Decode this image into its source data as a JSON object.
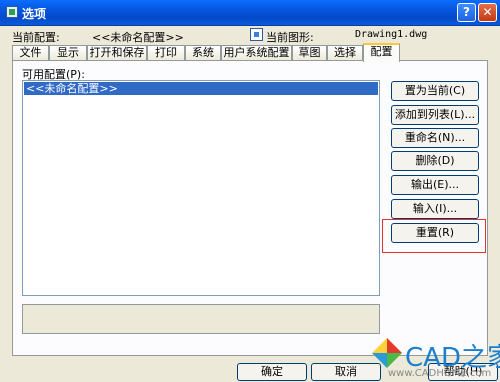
{
  "window": {
    "title": "选项",
    "help_glyph": "?",
    "close_glyph": "✕"
  },
  "info": {
    "current_profile_label": "当前配置:",
    "current_profile_value": "<<未命名配置>>",
    "current_drawing_label": "当前图形:",
    "current_drawing_value": "Drawing1.dwg"
  },
  "tabs": [
    {
      "label": "文件"
    },
    {
      "label": "显示"
    },
    {
      "label": "打开和保存"
    },
    {
      "label": "打印"
    },
    {
      "label": "系统"
    },
    {
      "label": "用户系统配置"
    },
    {
      "label": "草图"
    },
    {
      "label": "选择"
    },
    {
      "label": "配置",
      "active": true
    }
  ],
  "profiles": {
    "label": "可用配置(P):",
    "items": [
      "<<未命名配置>>"
    ]
  },
  "side_buttons": [
    "置为当前(C)",
    "添加到列表(L)...",
    "重命名(N)...",
    "删除(D)",
    "输出(E)...",
    "输入(I)...",
    "重置(R)"
  ],
  "bottom_buttons": [
    "确定",
    "取消",
    "帮助(H)"
  ],
  "watermark": {
    "text": "CAD之家",
    "url": "www.CADHOME.com"
  },
  "colors": {
    "title_bar": "#0758e0",
    "selection": "#316ac5",
    "highlight_box": "#e53030",
    "dialog_bg": "#ece9d8"
  }
}
